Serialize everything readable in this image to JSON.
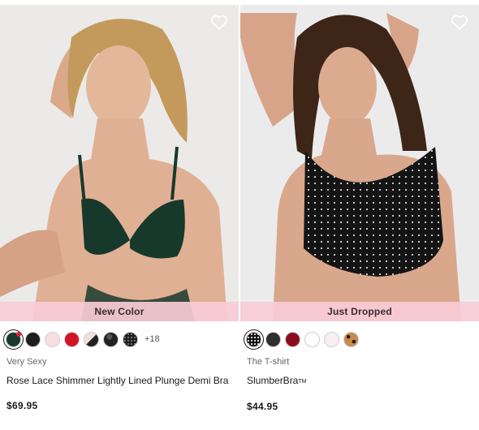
{
  "products": [
    {
      "badge": "New Color",
      "brand": "Very Sexy",
      "name": "Rose Lace Shimmer Lightly Lined Plunge Demi Bra",
      "price": "$69.95",
      "more_colors": "+18",
      "swatches": [
        {
          "color": "#173a2b",
          "selected": true,
          "new_dot": true
        },
        {
          "color": "#1e1e1e"
        },
        {
          "color": "#f7dfe2"
        },
        {
          "color": "#d31428"
        },
        {
          "color": "#efe0da"
        },
        {
          "color": "#222222"
        },
        {
          "color": "#1b1b1b"
        }
      ]
    },
    {
      "badge": "Just Dropped",
      "brand": "The T-shirt",
      "name": "SlumberBra",
      "name_tm": "TM",
      "price": "$44.95",
      "swatches": [
        {
          "color": "#111111",
          "selected": true
        },
        {
          "color": "#2f2f2f"
        },
        {
          "color": "#8b0d1d"
        },
        {
          "color": "#ffffff"
        },
        {
          "color": "#fbeef2"
        },
        {
          "color": "#c88a4d"
        }
      ]
    }
  ]
}
